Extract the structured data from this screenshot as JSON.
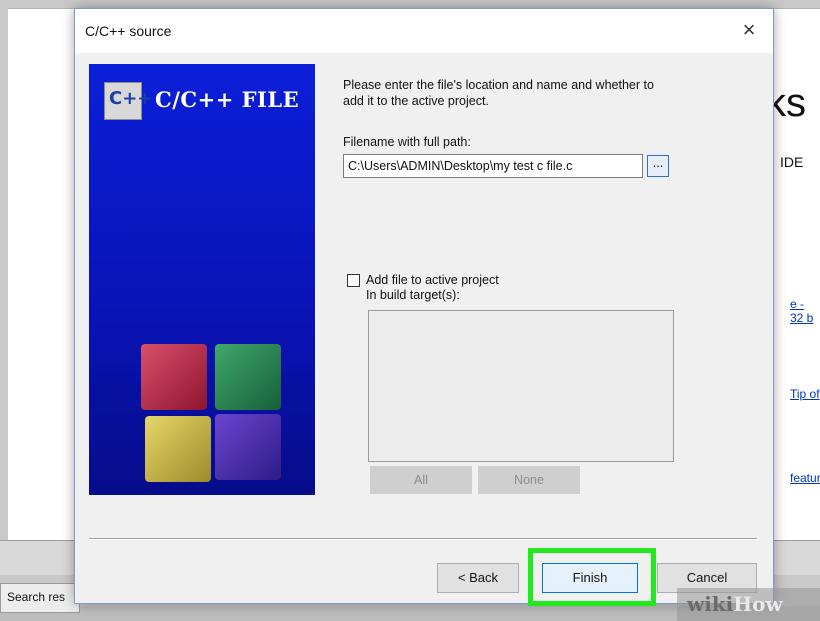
{
  "background": {
    "heading_fragment": "ks",
    "subheading_fragment": "IDE",
    "links": [
      "e - 32 b",
      "Tip of",
      "featur"
    ],
    "search_tab_label": "Search res"
  },
  "dialog": {
    "title": "C/C++ source",
    "close_glyph": "×",
    "banner": {
      "logo_text": "C++",
      "title": "C/C++ FILE"
    },
    "description": "Please enter the file's location and name and whether to add it to the active project.",
    "filename_label": "Filename with full path:",
    "filename_value": "C:\\Users\\ADMIN\\Desktop\\my test c file.c",
    "browse_label": "...",
    "add_to_project_label": "Add file to active project",
    "add_to_project_checked": false,
    "build_targets_label": "In build target(s):",
    "build_targets": [],
    "all_button": "All",
    "none_button": "None",
    "back_button": "< Back",
    "finish_button": "Finish",
    "cancel_button": "Cancel"
  },
  "watermark": {
    "wiki": "wiki",
    "how": "How"
  },
  "colors": {
    "banner_blue": "#0b1fd8",
    "highlight_green": "#22e81f",
    "focus_blue": "#0078d7"
  }
}
